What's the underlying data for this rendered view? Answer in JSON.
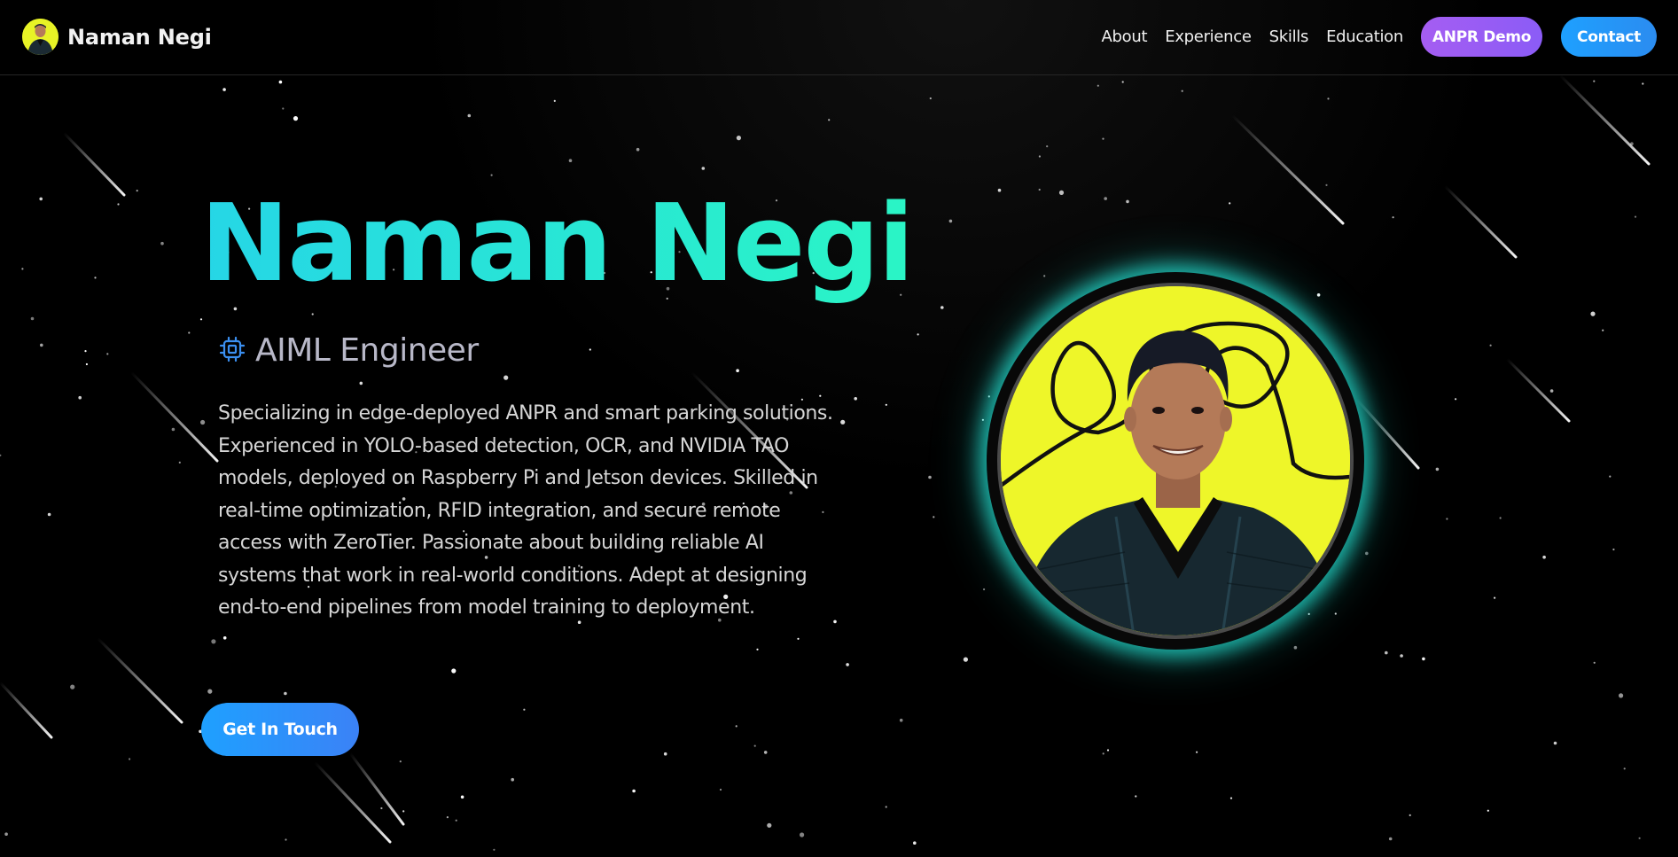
{
  "header": {
    "brand_name": "Naman Negi",
    "nav": [
      {
        "label": "About"
      },
      {
        "label": "Experience"
      },
      {
        "label": "Skills"
      },
      {
        "label": "Education"
      }
    ],
    "demo_button": "ANPR Demo",
    "contact_button": "Contact"
  },
  "hero": {
    "name": "Naman Negi",
    "role_icon": "cpu-chip-icon",
    "role": "AIML Engineer",
    "bio": "Specializing in edge-deployed ANPR and smart parking solutions. Experienced in YOLO-based detection, OCR, and NVIDIA TAO models, deployed on Raspberry Pi and Jetson devices. Skilled in real-time optimization, RFID integration, and secure remote access with ZeroTier. Passionate about building reliable AI systems that work in real-world conditions. Adept at designing end-to-end pipelines from model training to deployment.",
    "cta_button": "Get In Touch"
  },
  "colors": {
    "background": "#000000",
    "name_gradient_start": "#26d6e6",
    "name_gradient_end": "#2af5c5",
    "demo_button": "#a55df2",
    "contact_button": "#1ea0ff",
    "portrait_glow": "#26e6d7",
    "portrait_background": "#eef629"
  }
}
